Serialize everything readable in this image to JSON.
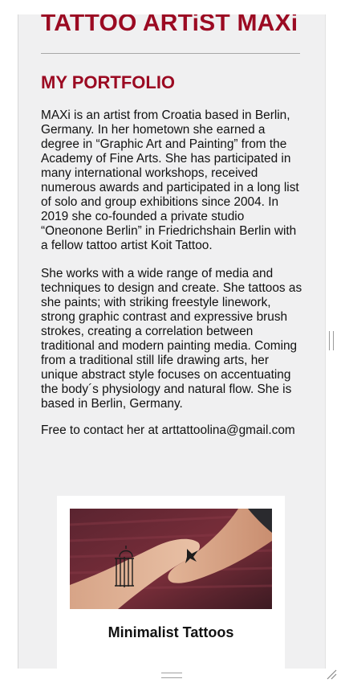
{
  "header": {
    "title": "TATTOO ARTiST MAXi"
  },
  "portfolio": {
    "heading": "MY PORTFOLIO",
    "paragraphs": [
      "MAXi is an artist from Croatia based in Berlin, Germany. In her hometown she earned a degree in “Graphic Art and Painting” from the Academy of Fine Arts. She has participated in many international workshops, received numerous awards and participated in a long list of solo and group exhibitions since 2004. In 2019 she co-founded a private studio “Oneonone Berlin” in Friedrichshain Berlin with a fellow tattoo artist Koit Tattoo.",
      "She works with a wide range of media and techniques to design and create. She tattoos as she paints; with striking freestyle linework, strong graphic contrast and expressive brush strokes, creating a correlation between traditional and modern painting media. Coming from a traditional still life drawing arts, her unique abstract style focuses on accentuating the body´s physiology and natural flow. She is based in Berlin, Germany.",
      "Free to contact her at arttattoolina@gmail.com"
    ]
  },
  "cards": [
    {
      "title": "Minimalist Tattoos",
      "image_icon": "birdcage-and-bird-tattoo-hands-photo"
    }
  ],
  "colors": {
    "accent": "#9b0a22",
    "panel_bg": "#f0f0f1",
    "card_bg": "#ffffff"
  }
}
